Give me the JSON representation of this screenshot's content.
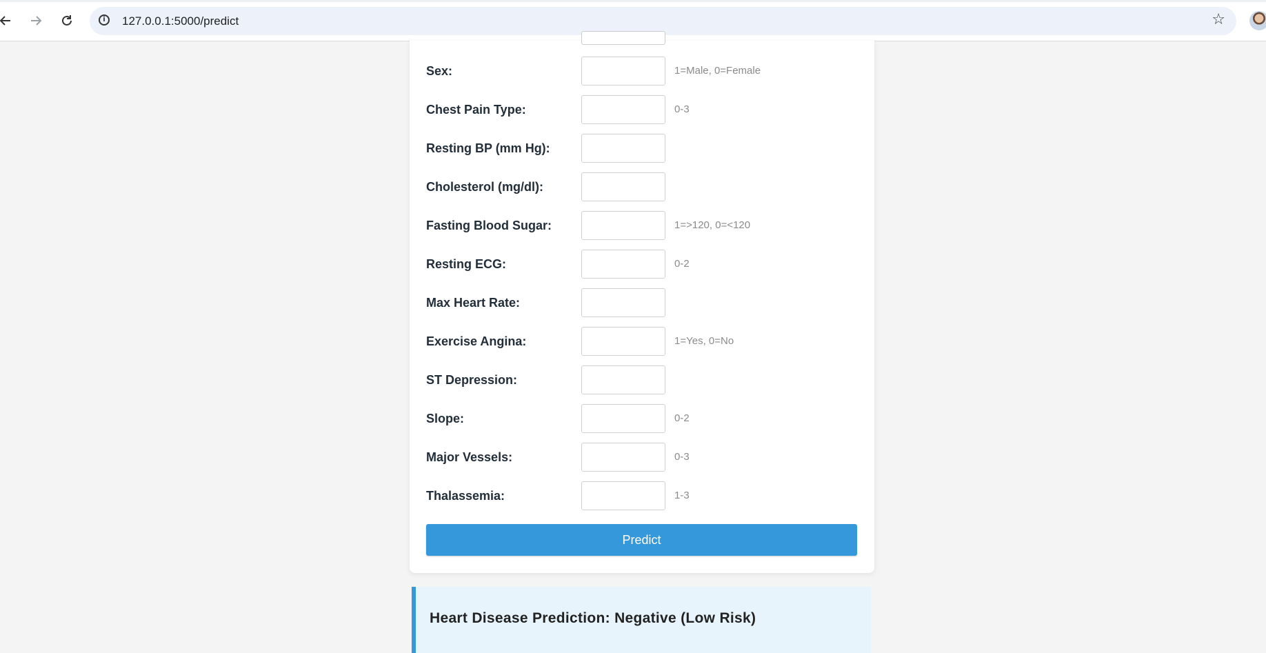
{
  "browser": {
    "url": "127.0.0.1:5000/predict",
    "back_icon": "arrow-left",
    "forward_icon": "arrow-right",
    "reload_icon": "reload",
    "info_icon": "info",
    "bookmark_icon": "star"
  },
  "form": {
    "fields": [
      {
        "label": "Sex:",
        "hint": "1=Male, 0=Female",
        "value": ""
      },
      {
        "label": "Chest Pain Type:",
        "hint": "0-3",
        "value": ""
      },
      {
        "label": "Resting BP (mm Hg):",
        "hint": "",
        "value": ""
      },
      {
        "label": "Cholesterol (mg/dl):",
        "hint": "",
        "value": ""
      },
      {
        "label": "Fasting Blood Sugar:",
        "hint": "1=>120, 0=<120",
        "value": ""
      },
      {
        "label": "Resting ECG:",
        "hint": "0-2",
        "value": ""
      },
      {
        "label": "Max Heart Rate:",
        "hint": "",
        "value": ""
      },
      {
        "label": "Exercise Angina:",
        "hint": "1=Yes, 0=No",
        "value": ""
      },
      {
        "label": "ST Depression:",
        "hint": "",
        "value": ""
      },
      {
        "label": "Slope:",
        "hint": "0-2",
        "value": ""
      },
      {
        "label": "Major Vessels:",
        "hint": "0-3",
        "value": ""
      },
      {
        "label": "Thalassemia:",
        "hint": "1-3",
        "value": ""
      }
    ],
    "submit_label": "Predict"
  },
  "result": {
    "text": "Heart Disease Prediction: Negative (Low Risk)"
  },
  "colors": {
    "accent": "#3498db",
    "result_bg": "#e8f4fc",
    "page_bg": "#f4f4f4"
  }
}
